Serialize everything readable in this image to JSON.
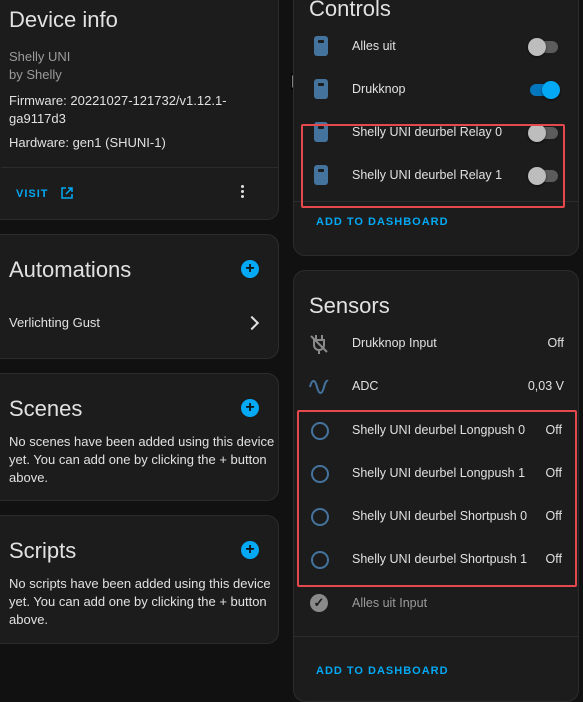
{
  "device_info": {
    "title": "Device info",
    "model": "Shelly UNI",
    "manufacturer": "by Shelly",
    "firmware_line1": "Firmware: 20221027-121732/v1.12.1-",
    "firmware_line2": "ga9117d3",
    "hardware": "Hardware: gen1 (SHUNI-1)",
    "visit_label": "VISIT"
  },
  "automations": {
    "title": "Automations",
    "items": [
      {
        "label": "Verlichting Gust"
      }
    ]
  },
  "scenes": {
    "title": "Scenes",
    "text1": "No scenes have been added using this device",
    "text2": "yet. You can add one by clicking the + button",
    "text3": "above."
  },
  "scripts": {
    "title": "Scripts",
    "text1": "No scripts have been added using this device",
    "text2": "yet. You can add one by clicking the + button",
    "text3": "above."
  },
  "controls": {
    "title": "Controls",
    "items": [
      {
        "label": "Alles uit",
        "state": "off"
      },
      {
        "label": "Drukknop",
        "state": "on"
      },
      {
        "label": "Shelly UNI deurbel Relay 0",
        "state": "off"
      },
      {
        "label": "Shelly UNI deurbel Relay 1",
        "state": "off"
      }
    ],
    "add_label": "ADD TO DASHBOARD"
  },
  "sensors": {
    "title": "Sensors",
    "items": [
      {
        "label": "Drukknop Input",
        "value": "Off",
        "icon": "power-plug-off-icon"
      },
      {
        "label": "ADC",
        "value": "0,03 V",
        "icon": "sine-wave-icon"
      },
      {
        "label": "Shelly UNI deurbel Longpush 0",
        "value": "Off",
        "icon": "circle-outline-icon"
      },
      {
        "label": "Shelly UNI deurbel Longpush 1",
        "value": "Off",
        "icon": "circle-outline-icon"
      },
      {
        "label": "Shelly UNI deurbel Shortpush 0",
        "value": "Off",
        "icon": "circle-outline-icon"
      },
      {
        "label": "Shelly UNI deurbel Shortpush 1",
        "value": "Off",
        "icon": "circle-outline-icon"
      }
    ],
    "disabled_item": {
      "label": "Alles uit Input",
      "icon": "check-circle-icon"
    },
    "add_label": "ADD TO DASHBOARD"
  },
  "colors": {
    "accent": "#03a9f4",
    "highlight": "#e5484d",
    "icon": "#44739e"
  }
}
